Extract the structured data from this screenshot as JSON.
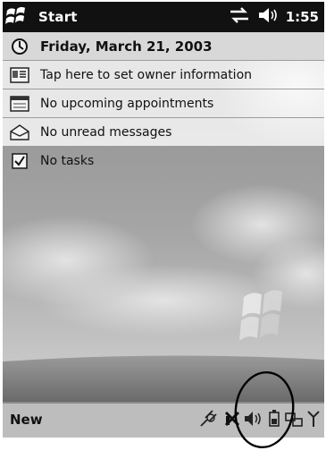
{
  "titlebar": {
    "start_label": "Start",
    "clock": "1:55",
    "icons": [
      "windows-flag-icon",
      "connectivity-icon",
      "speaker-icon"
    ]
  },
  "today": {
    "date": "Friday, March 21, 2003",
    "owner": "Tap here to set owner information",
    "appointments": "No upcoming appointments",
    "messages": "No unread messages",
    "tasks": "No tasks"
  },
  "menubar": {
    "new_label": "New",
    "tray_icons": [
      "connection-plug-icon",
      "signal-icon",
      "speaker-icon",
      "battery-icon",
      "network-icon",
      "antenna-icon"
    ]
  }
}
